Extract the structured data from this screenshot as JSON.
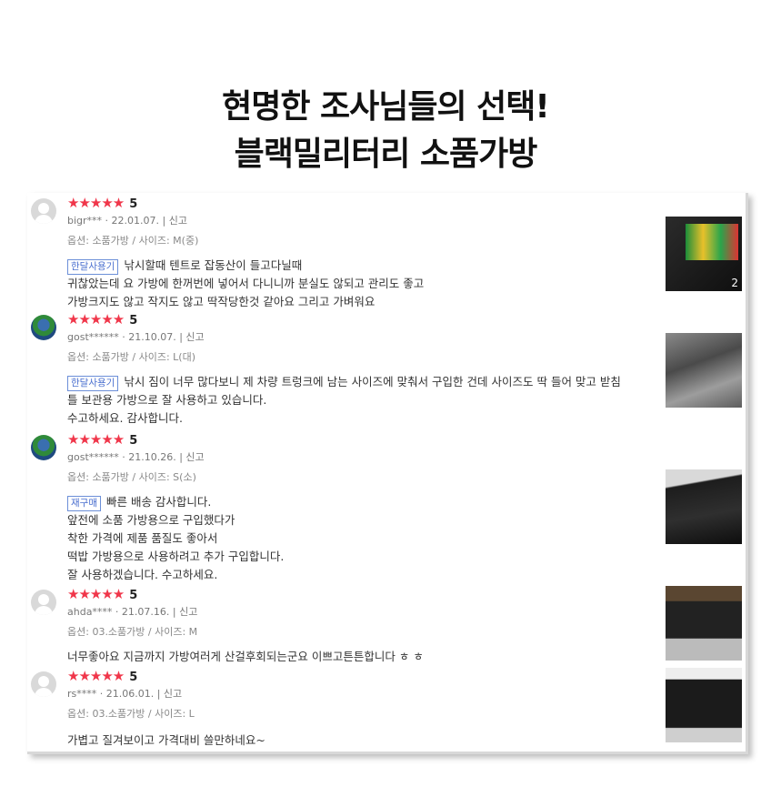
{
  "header": {
    "line1": "현명한 조사님들의 선택!",
    "line2": "블랙밀리터리 소품가방"
  },
  "reviews": [
    {
      "stars": "★★★★★",
      "score": "5",
      "meta": "bigr***  · 22.01.07.  |  신고",
      "option": "옵션: 소품가방 / 사이즈: M(중)",
      "tag": "한달사용기",
      "lines": [
        "낚시할때 텐트로 잡동산이 들고다닐때",
        "귀찮았는데 요 가방에 한꺼번에 넣어서 다니니까 분실도 않되고 관리도 좋고",
        "가방크지도 않고 작지도 않고 딱작당한것 같아요 그리고 가벼워요"
      ],
      "photo_count": "2"
    },
    {
      "stars": "★★★★★",
      "score": "5",
      "meta": "gost******  · 21.10.07.  |  신고",
      "option": "옵션: 소품가방 / 사이즈: L(대)",
      "tag": "한달사용기",
      "lines": [
        "낚시 짐이 너무 많다보니 제 차량 트렁크에 남는 사이즈에 맞춰서 구입한 건데 사이즈도 딱 들어 맞고 받침",
        "틀 보관용 가방으로 잘 사용하고 있습니다.",
        "수고하세요. 감사합니다."
      ]
    },
    {
      "stars": "★★★★★",
      "score": "5",
      "meta": "gost******  · 21.10.26.  |  신고",
      "option": "옵션: 소품가방 / 사이즈: S(소)",
      "tag": "재구매",
      "lines": [
        "빠른 배송 감사합니다.",
        "앞전에 소품 가방용으로 구입했다가",
        "착한 가격에 제품 품질도 좋아서",
        "떡밥 가방용으로 사용하려고 추가 구입합니다.",
        "잘 사용하겠습니다. 수고하세요."
      ]
    },
    {
      "stars": "★★★★★",
      "score": "5",
      "meta": "ahda****  · 21.07.16.  |  신고",
      "option": "옵션: 03.소품가방 / 사이즈: M",
      "lines": [
        "너무좋아요 지금까지 가방여러게 산걸후회되는군요 이쁘고튼튼합니다 ㅎ ㅎ"
      ]
    },
    {
      "stars": "★★★★★",
      "score": "5",
      "meta": "rs****  · 21.06.01.  |  신고",
      "option": "옵션: 03.소품가방 / 사이즈: L",
      "lines": [
        "가볍고 질겨보이고 가격대비 쓸만하네요~"
      ]
    }
  ]
}
